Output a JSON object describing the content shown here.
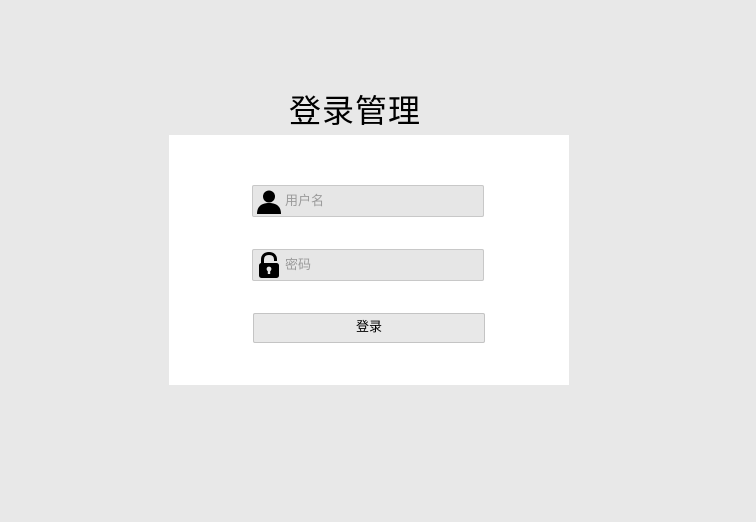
{
  "title": "登录管理",
  "form": {
    "username": {
      "placeholder": "用户名",
      "value": "",
      "icon": "user-icon"
    },
    "password": {
      "placeholder": "密码",
      "value": "",
      "icon": "lock-icon"
    },
    "submit_label": "登录"
  },
  "colors": {
    "background": "#e8e8e8",
    "card": "#ffffff",
    "field": "#e6e6e6",
    "border": "#c8c8c8"
  }
}
